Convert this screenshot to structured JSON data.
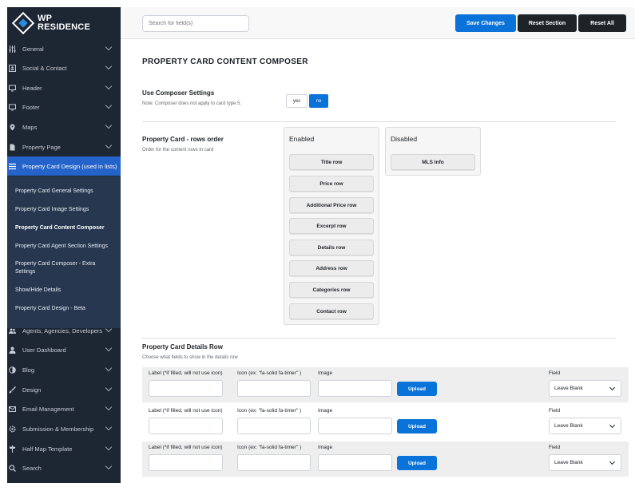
{
  "brand": {
    "line1": "WP",
    "line2": "RESIDENCE"
  },
  "sidebar": {
    "items": [
      {
        "label": "General",
        "icon": "sliders-icon"
      },
      {
        "label": "Social & Contact",
        "icon": "contact-card-icon"
      },
      {
        "label": "Header",
        "icon": "monitor-icon"
      },
      {
        "label": "Footer",
        "icon": "monitor-icon"
      },
      {
        "label": "Maps",
        "icon": "map-pin-icon"
      },
      {
        "label": "Property Page",
        "icon": "file-icon"
      },
      {
        "label": "Property Card Design (used in lists)",
        "icon": "menu-lines-icon"
      },
      {
        "label": "Agents, Agencies, Developers",
        "icon": "users-icon"
      },
      {
        "label": "User Dashboard",
        "icon": "user-icon"
      },
      {
        "label": "Blog",
        "icon": "circle-half-icon"
      },
      {
        "label": "Design",
        "icon": "brush-icon"
      },
      {
        "label": "Email Management",
        "icon": "envelope-icon"
      },
      {
        "label": "Submission & Membership",
        "icon": "gear-icon"
      },
      {
        "label": "Half Map Template",
        "icon": "map-sign-icon"
      },
      {
        "label": "Search",
        "icon": "search-icon"
      }
    ],
    "submenu": [
      "Property Card General Settings",
      "Property Card Image Settings",
      "Property Card Content Composer",
      "Property Card Agent Section Settings",
      "Property Card Composer - Extra Settings",
      "Show/Hide Details",
      "Property Card Design - Beta"
    ]
  },
  "topbar": {
    "search_placeholder": "Search for field(s)",
    "save_label": "Save Changes",
    "reset_section_label": "Reset Section",
    "reset_all_label": "Reset All"
  },
  "main": {
    "title": "PROPERTY CARD CONTENT COMPOSER",
    "composer": {
      "title": "Use Composer Settings",
      "note": "Note: Composer does not apply to card type 5.",
      "yes": "yes",
      "no": "no",
      "selected": "no"
    },
    "rows_order": {
      "title": "Property Card - rows order",
      "note": "Order for the content rows in card",
      "enabled_title": "Enabled",
      "enabled": [
        "Title row",
        "Price row",
        "Additional Price row",
        "Excerpt row",
        "Details row",
        "Address row",
        "Categories row",
        "Contact row"
      ],
      "disabled_title": "Disabled",
      "disabled": [
        "MLS Info"
      ]
    },
    "details": {
      "title": "Property Card Details Row",
      "note": "Choose what fields to show in the details row",
      "label_col": "Label (*if filled, will not use icon)",
      "icon_col": "Icon (ex: \"fa-solid fa-timer\" )",
      "image_col": "Image",
      "field_col": "Field",
      "upload_label": "Upload",
      "rows": [
        {
          "field": "Leave Blank"
        },
        {
          "field": "Leave Blank"
        },
        {
          "field": "Leave Blank"
        }
      ]
    }
  },
  "colors": {
    "accent": "#0a73d9",
    "sidebar_bg": "#1d2633",
    "active_bg": "#2463c9",
    "submenu_bg": "#26374f"
  }
}
